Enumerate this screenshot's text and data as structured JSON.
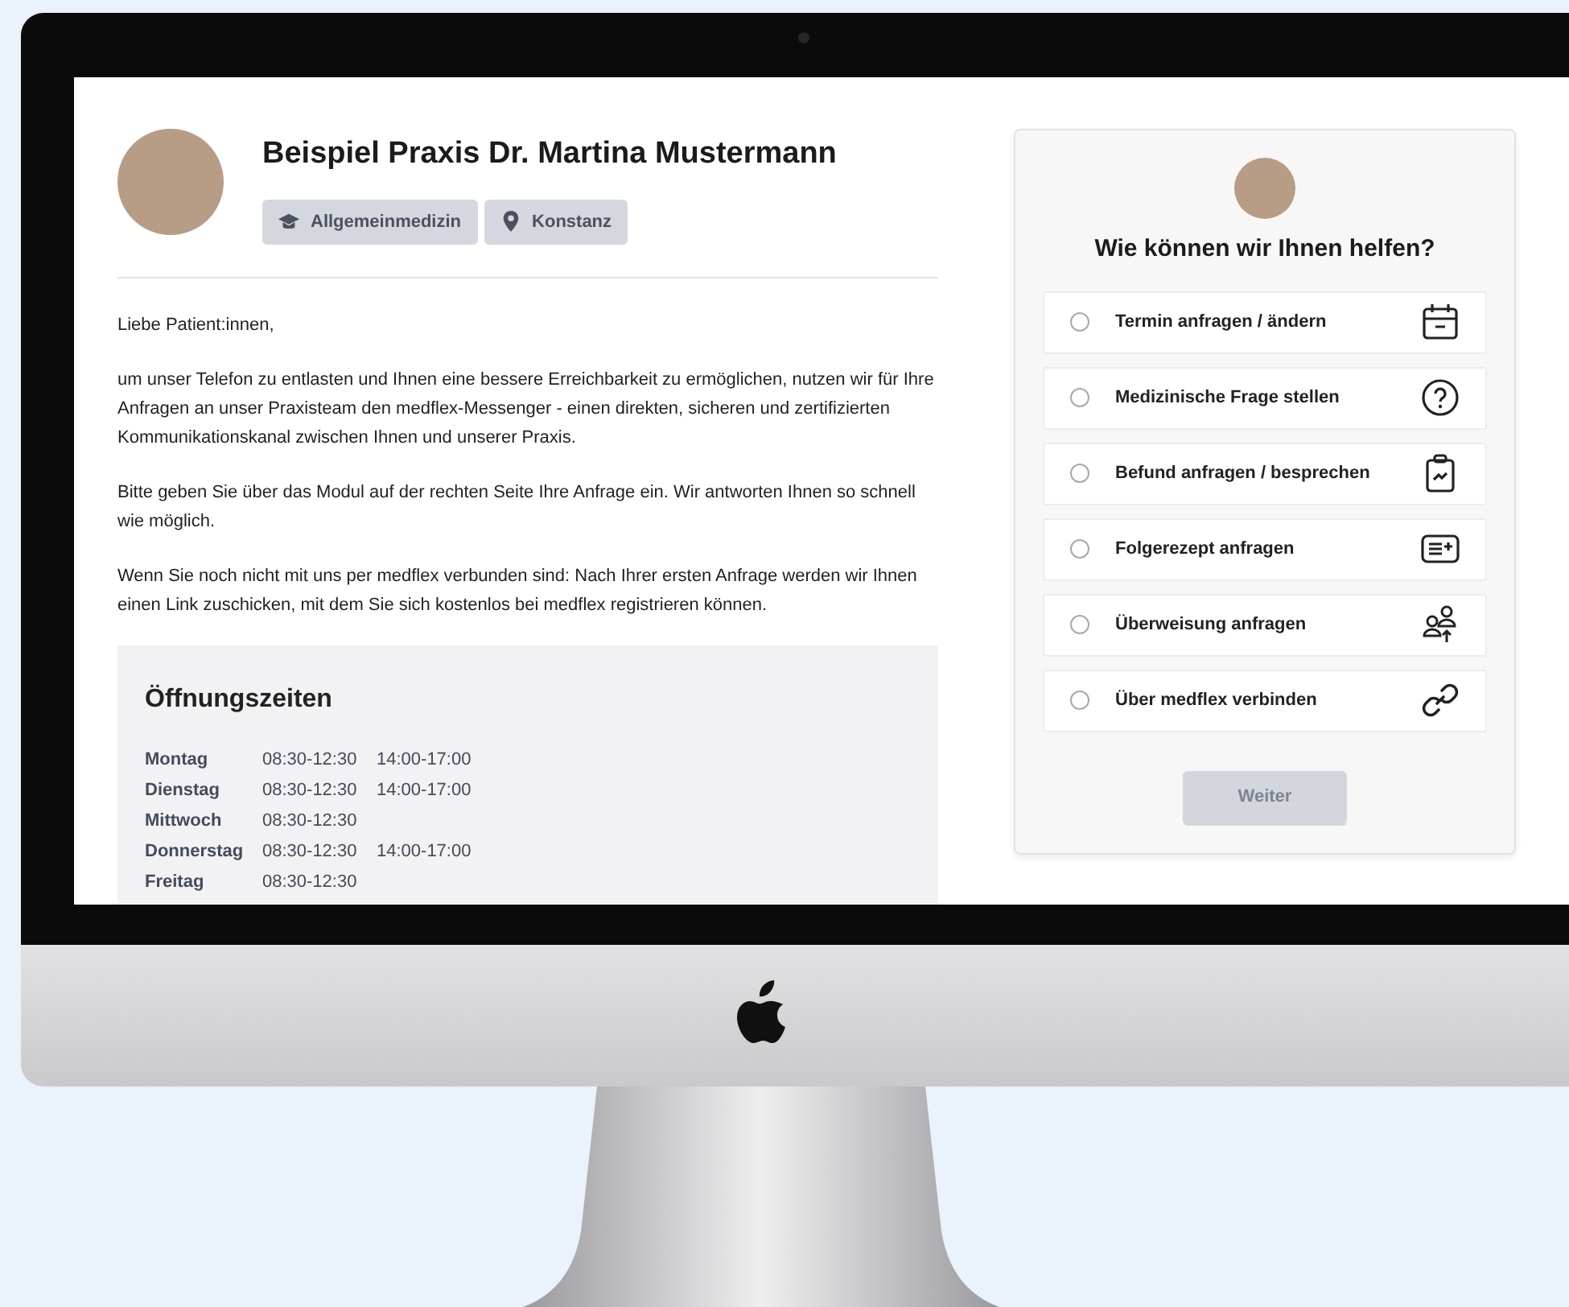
{
  "practice": {
    "name": "Beispiel Praxis Dr. Martina Mustermann",
    "tags": [
      {
        "kind": "specialty",
        "label": "Allgemeinmedizin"
      },
      {
        "kind": "location",
        "label": "Konstanz"
      }
    ]
  },
  "intro": [
    "Liebe Patient:innen,",
    "um unser Telefon zu entlasten und Ihnen eine bessere Erreichbarkeit zu ermöglichen, nutzen wir für Ihre Anfragen an unser Praxisteam den medflex-Messenger - einen direkten, sicheren und zertifizierten Kommunikationskanal zwischen Ihnen und unserer Praxis.",
    "Bitte geben Sie über das Modul auf der rechten Seite Ihre Anfrage ein. Wir antworten Ihnen so schnell wie möglich.",
    "Wenn Sie noch nicht mit uns per medflex verbunden sind: Nach Ihrer ersten Anfrage werden wir Ihnen einen Link zuschicken, mit dem Sie sich kostenlos bei medflex registrieren können."
  ],
  "hours": {
    "title": "Öffnungszeiten",
    "rows": [
      {
        "day": "Montag",
        "times": [
          "08:30-12:30",
          "14:00-17:00"
        ]
      },
      {
        "day": "Dienstag",
        "times": [
          "08:30-12:30",
          "14:00-17:00"
        ]
      },
      {
        "day": "Mittwoch",
        "times": [
          "08:30-12:30"
        ]
      },
      {
        "day": "Donnerstag",
        "times": [
          "08:30-12:30",
          "14:00-17:00"
        ]
      },
      {
        "day": "Freitag",
        "times": [
          "08:30-12:30"
        ]
      }
    ]
  },
  "help": {
    "title": "Wie können wir Ihnen helfen?",
    "options": [
      {
        "kind": "calendar",
        "label": "Termin anfragen / ändern",
        "selected": false
      },
      {
        "kind": "question",
        "label": "Medizinische Frage stellen",
        "selected": false
      },
      {
        "kind": "clipboard",
        "label": "Befund anfragen / besprechen",
        "selected": false
      },
      {
        "kind": "prescription",
        "label": "Folgerezept anfragen",
        "selected": false
      },
      {
        "kind": "referral",
        "label": "Überweisung anfragen",
        "selected": false
      },
      {
        "kind": "link",
        "label": "Über medflex verbinden",
        "selected": false
      }
    ],
    "button": {
      "label": "Weiter",
      "disabled": true
    }
  }
}
